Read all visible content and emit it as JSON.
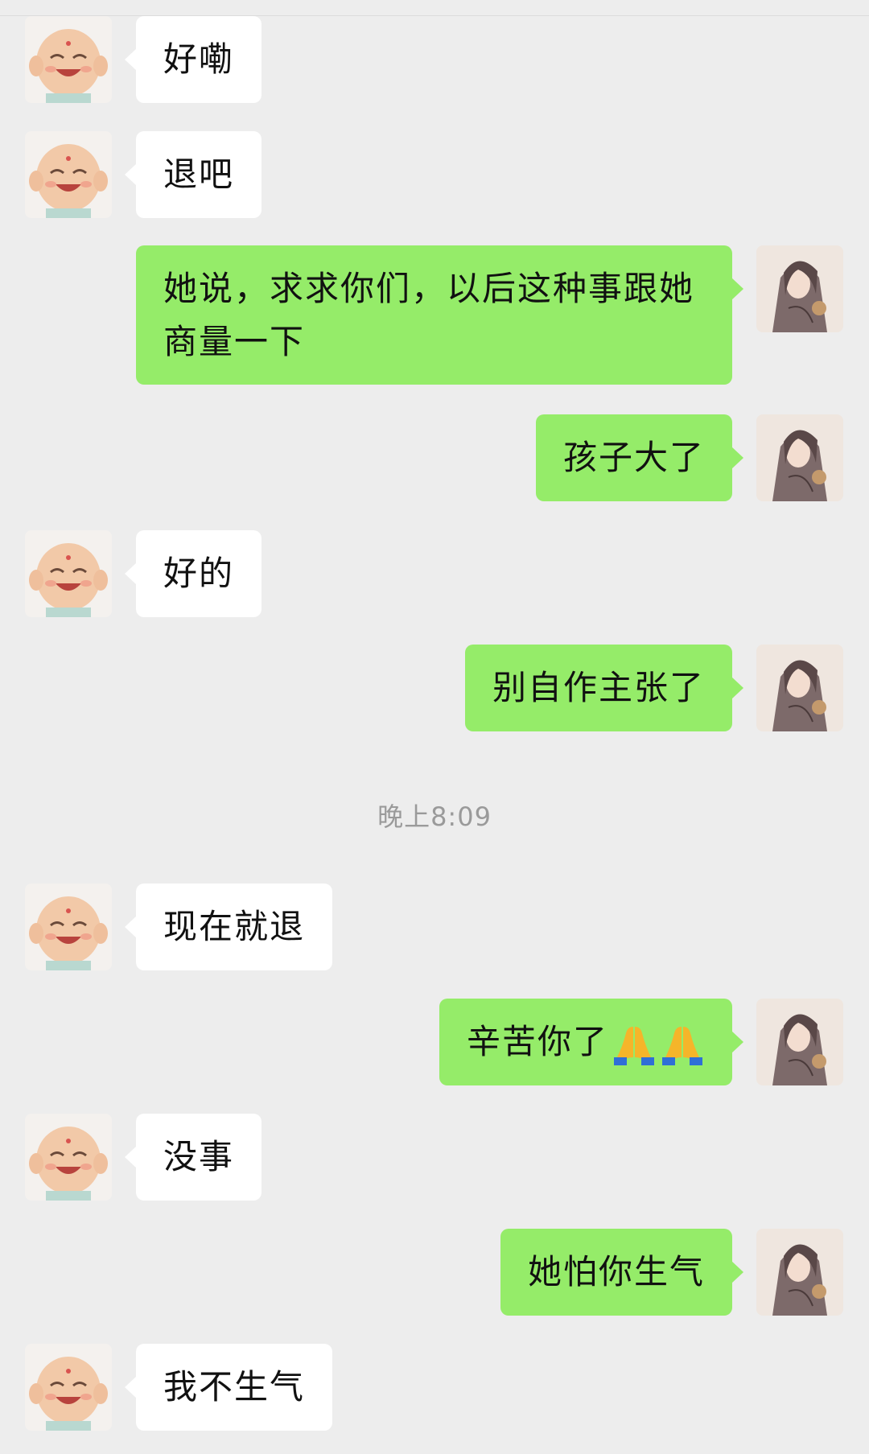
{
  "chat": {
    "messages": [
      {
        "side": "left",
        "text": "好嘞"
      },
      {
        "side": "left",
        "text": "退吧"
      },
      {
        "side": "right",
        "text": "她说，求求你们，以后这种事跟她商量一下"
      },
      {
        "side": "right",
        "text": "孩子大了"
      },
      {
        "side": "left",
        "text": "好的"
      },
      {
        "side": "right",
        "text": "别自作主张了"
      },
      {
        "side": "left",
        "text": "现在就退"
      },
      {
        "side": "right",
        "text": "辛苦你了",
        "emoji": [
          "folded-hands-icon",
          "folded-hands-icon"
        ]
      },
      {
        "side": "left",
        "text": "没事"
      },
      {
        "side": "right",
        "text": "她怕你生气"
      },
      {
        "side": "left",
        "text": "我不生气"
      }
    ],
    "timestamp": "晚上8:09"
  },
  "colors": {
    "background": "#ededed",
    "incoming_bubble": "#ffffff",
    "outgoing_bubble": "#95ec69",
    "timestamp_text": "#9a9a9a"
  },
  "icons": {
    "left_avatar": "smiling-monk-avatar",
    "right_avatar": "sketch-portrait-avatar"
  }
}
